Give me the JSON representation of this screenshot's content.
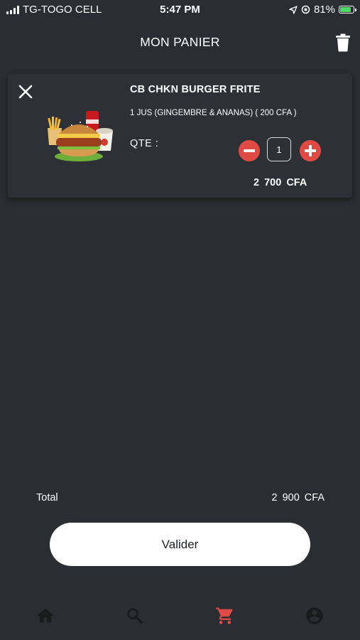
{
  "status_bar": {
    "carrier": "TG-TOGO CELL",
    "time": "5:47 PM",
    "battery": "81%",
    "battery_level": 0.81,
    "icons": [
      "signal-bars-icon",
      "location-arrow-icon",
      "alarm-icon",
      "battery-charging-icon"
    ]
  },
  "header": {
    "title": "MON PANIER",
    "trash_icon": "trash-icon"
  },
  "cart": {
    "items": [
      {
        "name": "CB CHKN BURGER FRITE",
        "option": "1 JUS (GINGEMBRE & ANANAS) ( 200 CFA )",
        "qty_label": "QTE  :",
        "qty": "1",
        "price": "2 700  CFA",
        "image": "burger-meal-image",
        "remove_icon": "close-icon"
      }
    ]
  },
  "total": {
    "label": "Total",
    "value": "2 900  CFA"
  },
  "validate_label": "Valider",
  "colors": {
    "background": "#2a2d31",
    "card": "#2d3035",
    "accent": "#e04a45",
    "nav_icon": "#1a1b1d",
    "button": "#ffffff"
  },
  "nav": {
    "items": [
      {
        "icon": "home-icon",
        "active": false
      },
      {
        "icon": "search-icon",
        "active": false
      },
      {
        "icon": "cart-icon",
        "active": true
      },
      {
        "icon": "account-icon",
        "active": false
      }
    ]
  }
}
